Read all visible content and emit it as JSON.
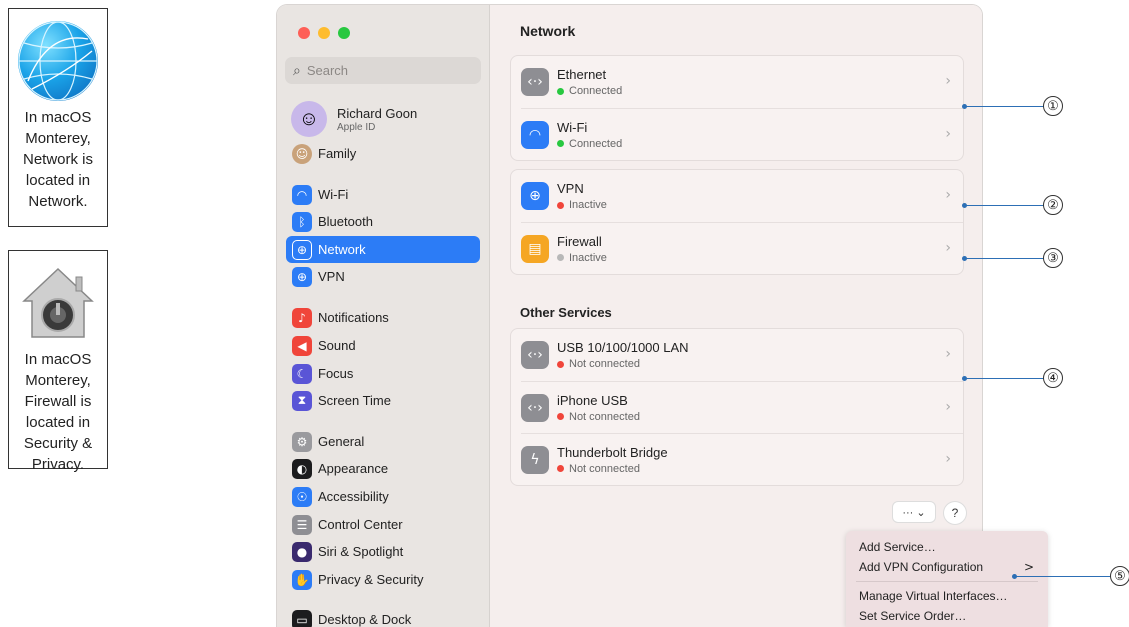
{
  "callouts": [
    {
      "text": "In macOS Monterey, Network is located in Network.",
      "icon": "globe-icon"
    },
    {
      "text": "In macOS Monterey, Firewall is located in Security & Privacy.",
      "icon": "lock-house-icon"
    }
  ],
  "sidebar": {
    "search_placeholder": "Search",
    "account": {
      "name": "Richard Goon",
      "sub": "Apple ID"
    },
    "family": "Family",
    "items": [
      {
        "label": "Wi-Fi",
        "icon": "wifi-icon",
        "color": "#2c7cf6"
      },
      {
        "label": "Bluetooth",
        "icon": "bluetooth-icon",
        "color": "#2c7cf6"
      },
      {
        "label": "Network",
        "icon": "globe-icon",
        "color": "#2c7cf6"
      },
      {
        "label": "VPN",
        "icon": "vpn-icon",
        "color": "#2c7cf6"
      },
      {
        "label": "Notifications",
        "icon": "bell-icon",
        "color": "#f0453a"
      },
      {
        "label": "Sound",
        "icon": "speaker-icon",
        "color": "#f0453a"
      },
      {
        "label": "Focus",
        "icon": "moon-icon",
        "color": "#5a55d6"
      },
      {
        "label": "Screen Time",
        "icon": "hourglass-icon",
        "color": "#5a55d6"
      },
      {
        "label": "General",
        "icon": "gear-icon",
        "color": "#9a9a9e"
      },
      {
        "label": "Appearance",
        "icon": "appearance-icon",
        "color": "#1c1c1e"
      },
      {
        "label": "Accessibility",
        "icon": "accessibility-icon",
        "color": "#2c7cf6"
      },
      {
        "label": "Control Center",
        "icon": "control-center-icon",
        "color": "#8e8e93"
      },
      {
        "label": "Siri & Spotlight",
        "icon": "siri-icon",
        "color": "#3a2a6e"
      },
      {
        "label": "Privacy & Security",
        "icon": "hand-icon",
        "color": "#2c7cf6"
      },
      {
        "label": "Desktop & Dock",
        "icon": "dock-icon",
        "color": "#1c1c1e"
      }
    ],
    "active": "Network"
  },
  "main": {
    "title": "Network",
    "groups": [
      [
        {
          "name": "Ethernet",
          "status": "Connected",
          "status_color": "#28c840",
          "icon": "ethernet-icon",
          "icon_color": "#8e8e93"
        },
        {
          "name": "Wi-Fi",
          "status": "Connected",
          "status_color": "#28c840",
          "icon": "wifi-icon",
          "icon_color": "#2c7cf6"
        }
      ],
      [
        {
          "name": "VPN",
          "status": "Inactive",
          "status_color": "#f0453a",
          "icon": "vpn-icon",
          "icon_color": "#2c7cf6"
        },
        {
          "name": "Firewall",
          "status": "Inactive",
          "status_color": "#b8b8b8",
          "icon": "firewall-icon",
          "icon_color": "#f5a623"
        }
      ]
    ],
    "other_title": "Other Services",
    "other": [
      {
        "name": "USB 10/100/1000 LAN",
        "status": "Not connected",
        "status_color": "#f0453a",
        "icon": "ethernet-icon",
        "icon_color": "#8e8e93"
      },
      {
        "name": "iPhone USB",
        "status": "Not connected",
        "status_color": "#f0453a",
        "icon": "ethernet-icon",
        "icon_color": "#8e8e93"
      },
      {
        "name": "Thunderbolt Bridge",
        "status": "Not connected",
        "status_color": "#f0453a",
        "icon": "thunderbolt-icon",
        "icon_color": "#8e8e93"
      }
    ],
    "more_label": "··· ⌄",
    "help_label": "?"
  },
  "menu": {
    "items": [
      "Add Service…",
      "Add VPN Configuration",
      "Manage Virtual Interfaces…",
      "Set Service Order…"
    ],
    "submenu_arrow": ">"
  },
  "annotations": [
    "①",
    "②",
    "③",
    "④",
    "⑤"
  ]
}
